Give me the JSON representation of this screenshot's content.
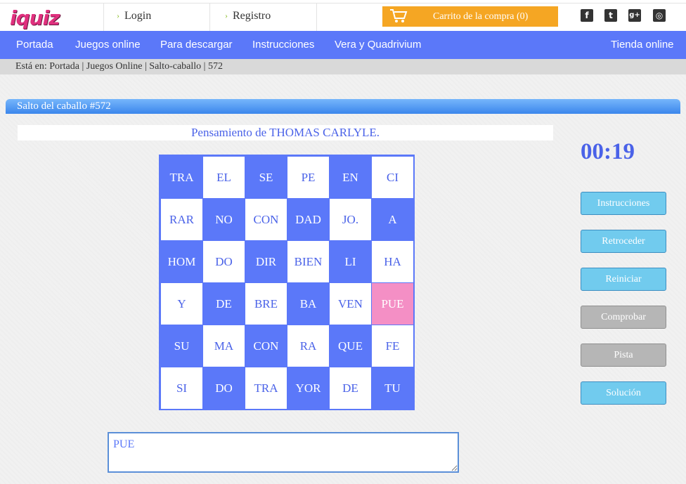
{
  "header": {
    "logo_text": "iquiz",
    "login_label": "Login",
    "register_label": "Registro",
    "cart_label": "Carrito de la compra (0)",
    "cart_color": "#f5a623",
    "social": [
      {
        "icon": "facebook-icon",
        "glyph": "f"
      },
      {
        "icon": "twitter-icon",
        "glyph": "t"
      },
      {
        "icon": "google-plus-icon",
        "glyph": "g+"
      },
      {
        "icon": "instagram-icon",
        "glyph": "◎"
      }
    ]
  },
  "nav": {
    "items": [
      "Portada",
      "Juegos online",
      "Para descargar",
      "Instrucciones",
      "Vera y Quadrivium"
    ],
    "store": "Tienda online",
    "color": "#5b78f9"
  },
  "breadcrumb": "Está en: Portada | Juegos Online | Salto-caballo | 572",
  "puzzle": {
    "title": "Salto del caballo #572",
    "subtitle": "Pensamiento de THOMAS CARLYLE.",
    "grid": [
      [
        "TRA",
        "EL",
        "SE",
        "PE",
        "EN",
        "CI"
      ],
      [
        "RAR",
        "NO",
        "CON",
        "DAD",
        "JO.",
        "A"
      ],
      [
        "HOM",
        "DO",
        "DIR",
        "BIEN",
        "LI",
        "HA"
      ],
      [
        "Y",
        "DE",
        "BRE",
        "BA",
        "VEN",
        "PUE"
      ],
      [
        "SU",
        "MA",
        "CON",
        "RA",
        "QUE",
        "FE"
      ],
      [
        "SI",
        "DO",
        "TRA",
        "YOR",
        "DE",
        "TU"
      ]
    ],
    "selected_cell": "PUE",
    "selected_color": "#f48fc5",
    "answer_text": "PUE"
  },
  "sidebar": {
    "timer": "00:19",
    "buttons": [
      {
        "label": "Instrucciones",
        "state": "active"
      },
      {
        "label": "Retroceder",
        "state": "active"
      },
      {
        "label": "Reiniciar",
        "state": "active"
      },
      {
        "label": "Comprobar",
        "state": "disabled"
      },
      {
        "label": "Pista",
        "state": "disabled"
      },
      {
        "label": "Solución",
        "state": "active"
      }
    ]
  }
}
